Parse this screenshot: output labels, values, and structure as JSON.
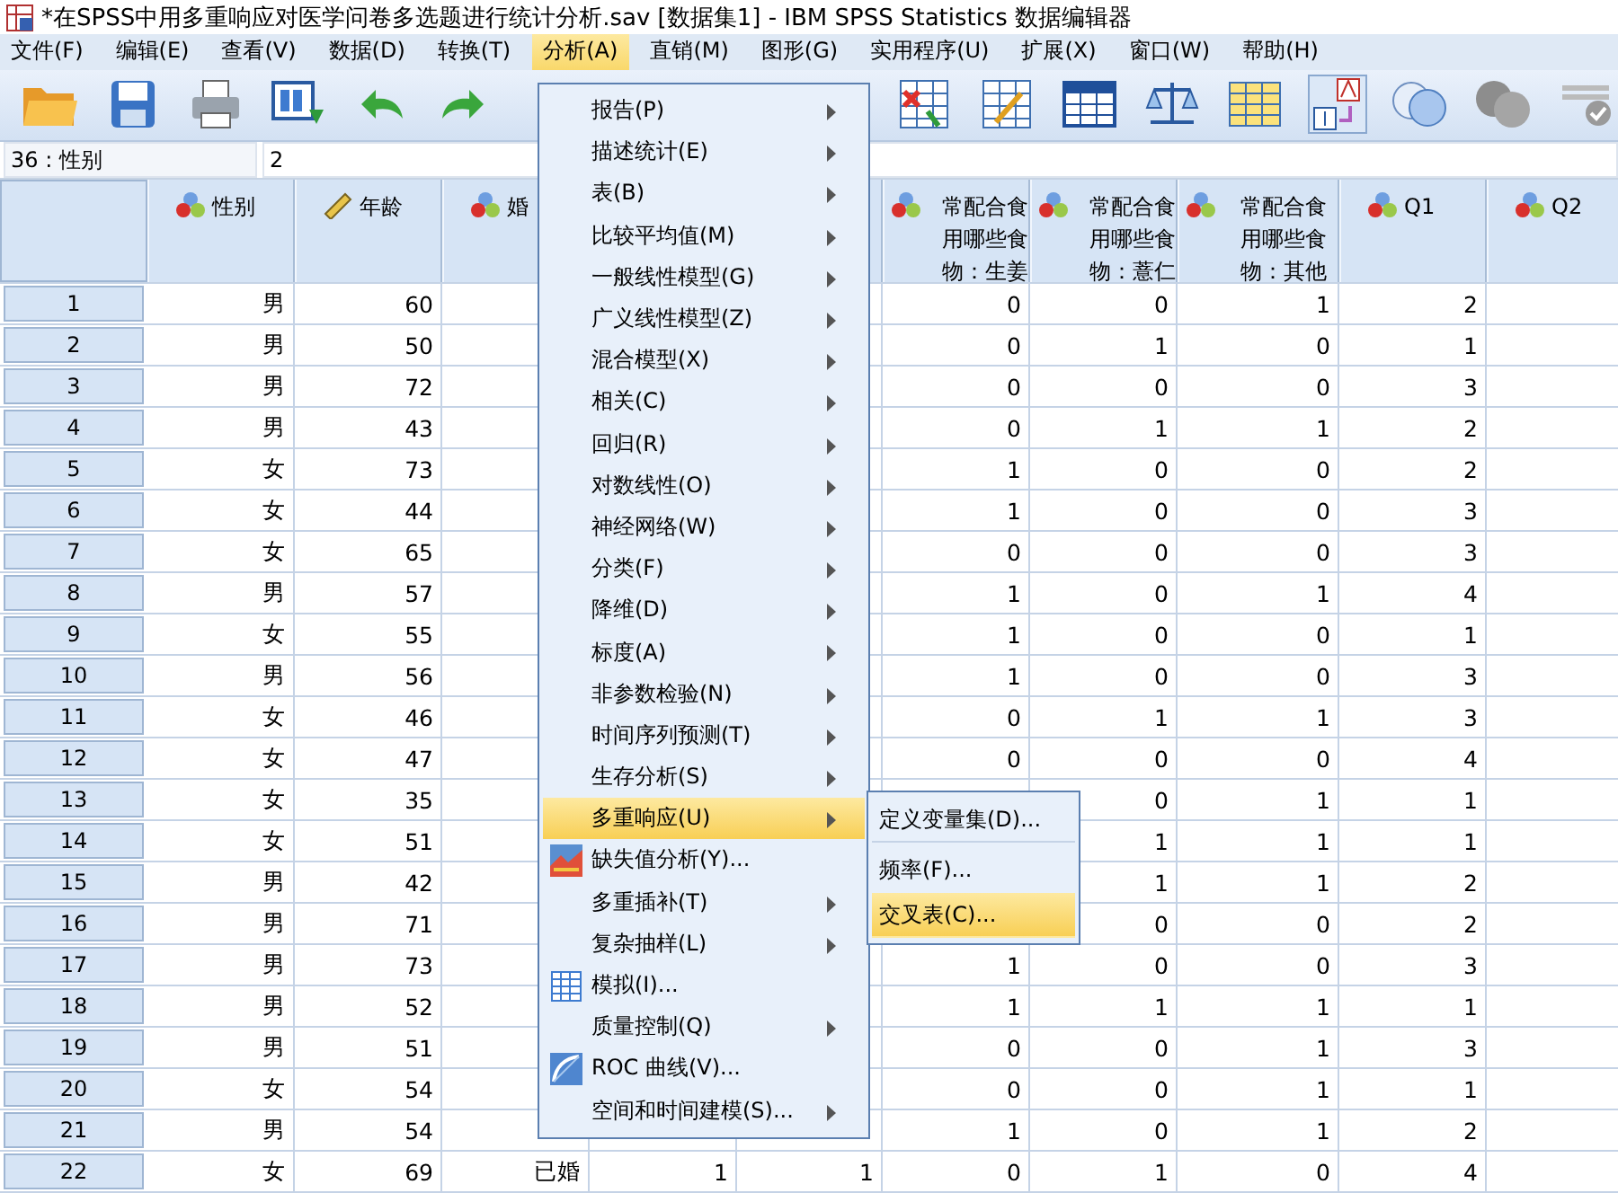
{
  "window": {
    "title": "*在SPSS中用多重响应对医学问卷多选题进行统计分析.sav [数据集1] - IBM SPSS Statistics 数据编辑器"
  },
  "menu_bar": [
    {
      "label": "文件(F)",
      "selected": false
    },
    {
      "label": "编辑(E)",
      "selected": false
    },
    {
      "label": "查看(V)",
      "selected": false
    },
    {
      "label": "数据(D)",
      "selected": false
    },
    {
      "label": "转换(T)",
      "selected": false
    },
    {
      "label": "分析(A)",
      "selected": true
    },
    {
      "label": "直销(M)",
      "selected": false
    },
    {
      "label": "图形(G)",
      "selected": false
    },
    {
      "label": "实用程序(U)",
      "selected": false
    },
    {
      "label": "扩展(X)",
      "selected": false
    },
    {
      "label": "窗口(W)",
      "selected": false
    },
    {
      "label": "帮助(H)",
      "selected": false
    }
  ],
  "cell_ref": {
    "name": "36 : 性别",
    "value": "2"
  },
  "grid": {
    "columns": [
      {
        "label": "性别",
        "kind": "nominal"
      },
      {
        "label": "年龄",
        "kind": "scale"
      },
      {
        "label": "婚",
        "kind": "nominal"
      },
      {},
      {},
      {
        "label": "常配合食用哪些食物：生姜",
        "kind": "nominal"
      },
      {
        "label": "常配合食用哪些食物：薏仁",
        "kind": "nominal"
      },
      {
        "label": "常配合食用哪些食物：其他",
        "kind": "nominal"
      },
      {
        "label": "Q1",
        "kind": "nominal"
      },
      {
        "label": "Q2",
        "kind": "nominal"
      }
    ],
    "rows": [
      {
        "number": "1",
        "cells": [
          "男",
          "60",
          null,
          null,
          null,
          "0",
          "0",
          "1",
          "2",
          null
        ]
      },
      {
        "number": "2",
        "cells": [
          "男",
          "50",
          null,
          null,
          null,
          "0",
          "1",
          "0",
          "1",
          null
        ]
      },
      {
        "number": "3",
        "cells": [
          "男",
          "72",
          null,
          null,
          null,
          "0",
          "0",
          "0",
          "3",
          null
        ]
      },
      {
        "number": "4",
        "cells": [
          "男",
          "43",
          null,
          null,
          null,
          "0",
          "1",
          "1",
          "2",
          null
        ]
      },
      {
        "number": "5",
        "cells": [
          "女",
          "73",
          null,
          null,
          null,
          "1",
          "0",
          "0",
          "2",
          null
        ]
      },
      {
        "number": "6",
        "cells": [
          "女",
          "44",
          null,
          null,
          null,
          "1",
          "0",
          "0",
          "3",
          null
        ]
      },
      {
        "number": "7",
        "cells": [
          "女",
          "65",
          null,
          null,
          null,
          "0",
          "0",
          "0",
          "3",
          null
        ]
      },
      {
        "number": "8",
        "cells": [
          "男",
          "57",
          null,
          null,
          null,
          "1",
          "0",
          "1",
          "4",
          null
        ]
      },
      {
        "number": "9",
        "cells": [
          "女",
          "55",
          null,
          null,
          null,
          "1",
          "0",
          "0",
          "1",
          null
        ]
      },
      {
        "number": "10",
        "cells": [
          "男",
          "56",
          null,
          null,
          null,
          "1",
          "0",
          "0",
          "3",
          null
        ]
      },
      {
        "number": "11",
        "cells": [
          "女",
          "46",
          null,
          null,
          null,
          "0",
          "1",
          "1",
          "3",
          null
        ]
      },
      {
        "number": "12",
        "cells": [
          "女",
          "47",
          null,
          null,
          null,
          "0",
          "0",
          "0",
          "4",
          null
        ]
      },
      {
        "number": "13",
        "cells": [
          "女",
          "35",
          null,
          null,
          null,
          null,
          "0",
          "1",
          "1",
          null
        ]
      },
      {
        "number": "14",
        "cells": [
          "女",
          "51",
          null,
          null,
          null,
          null,
          "1",
          "1",
          "1",
          null
        ]
      },
      {
        "number": "15",
        "cells": [
          "男",
          "42",
          null,
          null,
          null,
          null,
          "1",
          "1",
          "2",
          null
        ]
      },
      {
        "number": "16",
        "cells": [
          "男",
          "71",
          null,
          null,
          null,
          null,
          "0",
          "0",
          "2",
          null
        ]
      },
      {
        "number": "17",
        "cells": [
          "男",
          "73",
          null,
          null,
          null,
          "1",
          "0",
          "0",
          "3",
          null
        ]
      },
      {
        "number": "18",
        "cells": [
          "男",
          "52",
          null,
          null,
          null,
          "1",
          "1",
          "1",
          "1",
          null
        ]
      },
      {
        "number": "19",
        "cells": [
          "男",
          "51",
          null,
          null,
          null,
          "0",
          "0",
          "1",
          "3",
          null
        ]
      },
      {
        "number": "20",
        "cells": [
          "女",
          "54",
          null,
          null,
          null,
          "0",
          "0",
          "1",
          "1",
          null
        ]
      },
      {
        "number": "21",
        "cells": [
          "男",
          "54",
          null,
          null,
          null,
          "1",
          "0",
          "1",
          "2",
          null
        ]
      },
      {
        "number": "22",
        "cells": [
          "女",
          "69",
          "已婚",
          "1",
          "1",
          "0",
          "1",
          "0",
          "4",
          null
        ]
      }
    ]
  },
  "analysis_menu": {
    "items": [
      {
        "label": "报告(P)",
        "kind": "submenu",
        "selected": false
      },
      {
        "label": "描述统计(E)",
        "kind": "submenu",
        "selected": false
      },
      {
        "label": "表(B)",
        "kind": "submenu",
        "selected": false
      },
      {
        "label": "比较平均值(M)",
        "kind": "submenu",
        "selected": false
      },
      {
        "label": "一般线性模型(G)",
        "kind": "submenu",
        "selected": false
      },
      {
        "label": "广义线性模型(Z)",
        "kind": "submenu",
        "selected": false
      },
      {
        "label": "混合模型(X)",
        "kind": "submenu",
        "selected": false
      },
      {
        "label": "相关(C)",
        "kind": "submenu",
        "selected": false
      },
      {
        "label": "回归(R)",
        "kind": "submenu",
        "selected": false
      },
      {
        "label": "对数线性(O)",
        "kind": "submenu",
        "selected": false
      },
      {
        "label": "神经网络(W)",
        "kind": "submenu",
        "selected": false
      },
      {
        "label": "分类(F)",
        "kind": "submenu",
        "selected": false
      },
      {
        "label": "降维(D)",
        "kind": "submenu",
        "selected": false
      },
      {
        "label": "标度(A)",
        "kind": "submenu",
        "selected": false
      },
      {
        "label": "非参数检验(N)",
        "kind": "submenu",
        "selected": false
      },
      {
        "label": "时间序列预测(T)",
        "kind": "submenu",
        "selected": false
      },
      {
        "label": "生存分析(S)",
        "kind": "submenu",
        "selected": false
      },
      {
        "label": "多重响应(U)",
        "kind": "submenu",
        "selected": true
      },
      {
        "label": "缺失值分析(Y)...",
        "kind": "tool",
        "selected": false
      },
      {
        "label": "多重插补(T)",
        "kind": "submenu",
        "selected": false
      },
      {
        "label": "复杂抽样(L)",
        "kind": "submenu",
        "selected": false
      },
      {
        "label": "模拟(I)...",
        "kind": "tool",
        "selected": false
      },
      {
        "label": "质量控制(Q)",
        "kind": "submenu",
        "selected": false
      },
      {
        "label": "ROC 曲线(V)...",
        "kind": "tool",
        "selected": false
      },
      {
        "label": "空间和时间建模(S)...",
        "kind": "submenu",
        "selected": false
      }
    ]
  },
  "multiple_response_menu": {
    "items": [
      {
        "label": "定义变量集(D)...",
        "selected": false,
        "separator_after": true
      },
      {
        "label": "频率(F)...",
        "selected": false,
        "separator_after": false
      },
      {
        "label": "交叉表(C)...",
        "selected": true,
        "separator_after": false
      }
    ]
  }
}
